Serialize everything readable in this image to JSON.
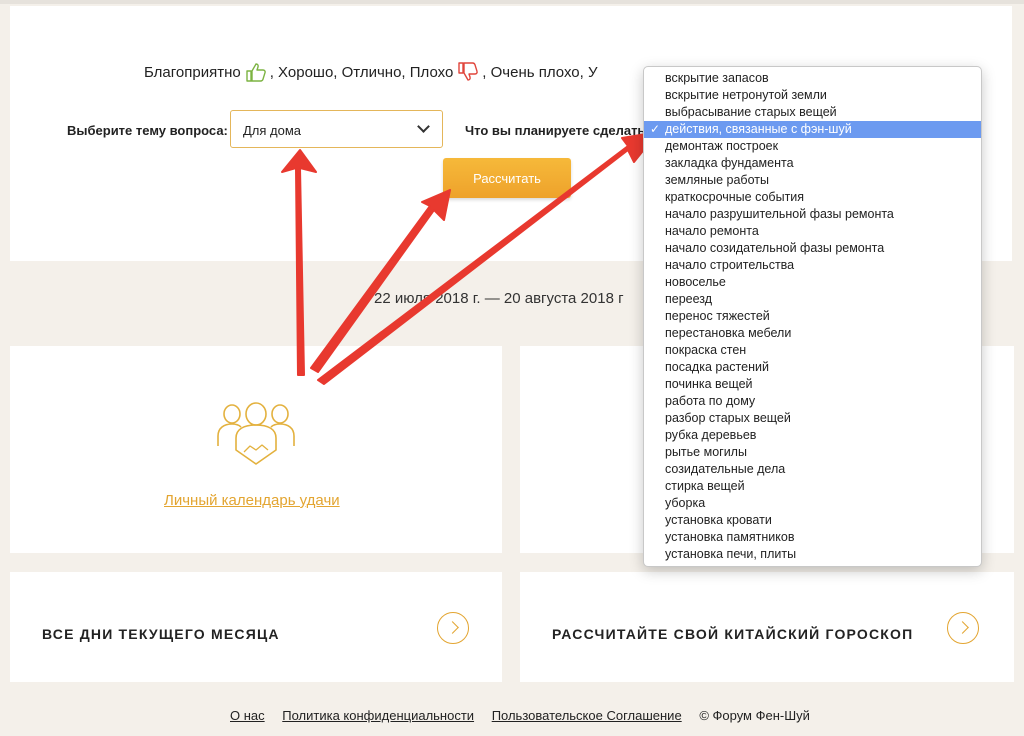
{
  "legend": {
    "w1": "Благоприятно",
    "w2": ", Хорошо, Отлично, Плохо",
    "w3": ", Очень плохо, У",
    "good_icon": "thumbs-up-icon",
    "bad_icon": "thumbs-down-icon"
  },
  "form": {
    "topic_label": "Выберите тему вопроса:",
    "topic_value": "Для дома",
    "plan_label": "Что вы планируете сделать?",
    "calculate_label": "Рассчитать"
  },
  "date_range": "22 июля 2018 г. — 20 августа 2018 г",
  "cards": {
    "lucky_calendar": "Личный календарь удачи",
    "all_days": "ВСЕ ДНИ ТЕКУЩЕГО МЕСЯЦА",
    "chinese_horoscope": "РАССЧИТАЙТЕ СВОЙ КИТАЙСКИЙ ГОРОСКОП"
  },
  "dropdown": {
    "selected_index": 3,
    "check_mark": "✓",
    "options": [
      "вскрытие запасов",
      "вскрытие нетронутой земли",
      "выбрасывание старых вещей",
      "действия, связанные с фэн-шуй",
      "демонтаж построек",
      "закладка фундамента",
      "земляные работы",
      "краткосрочные события",
      "начало разрушительной фазы ремонта",
      "начало ремонта",
      "начало созидательной фазы ремонта",
      "начало строительства",
      "новоселье",
      "переезд",
      "перенос тяжестей",
      "перестановка мебели",
      "покраска стен",
      "посадка растений",
      "починка вещей",
      "работа по дому",
      "разбор старых вещей",
      "рубка деревьев",
      "рытье могилы",
      "созидательные дела",
      "стирка вещей",
      "уборка",
      "установка кровати",
      "установка памятников",
      "установка печи, плиты"
    ]
  },
  "footer": {
    "about": "О нас",
    "privacy": "Политика конфиденциальности",
    "agreement": "Пользовательское Соглашение",
    "copyright": "© Форум Фен-Шуй"
  },
  "colors": {
    "accent": "#e3a531",
    "button": "#f0a82f",
    "selection": "#6c9af0",
    "arrow": "#e8392f"
  }
}
